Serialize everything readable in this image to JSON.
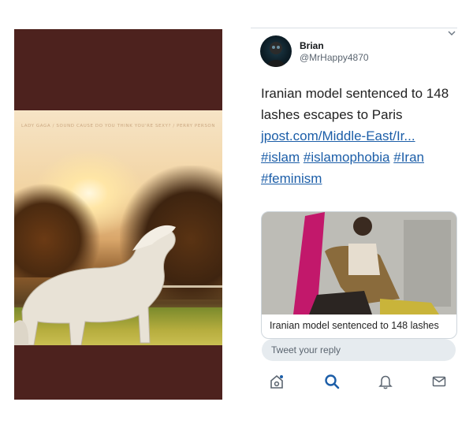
{
  "story": {
    "caption": "LADY GAGA / SOUND CAUSE DO YOU THINK YOU'RE SEXY? / PERRY PERSON"
  },
  "tweet": {
    "author_name": "Brian",
    "author_handle": "@MrHappy4870",
    "text": "Iranian model sentenced to 148 lashes escapes to Paris",
    "link": "jpost.com/Middle-East/Ir...",
    "hashtags": [
      "#islam",
      "#islamophobia",
      "#Iran",
      "#feminism"
    ],
    "media_title": "Iranian model sentenced to 148 lashes"
  },
  "reply": {
    "placeholder": "Tweet your reply"
  },
  "nav": {
    "items": [
      "home-icon",
      "search-icon",
      "notifications-icon",
      "messages-icon"
    ],
    "accent": "#1c5ea8"
  }
}
